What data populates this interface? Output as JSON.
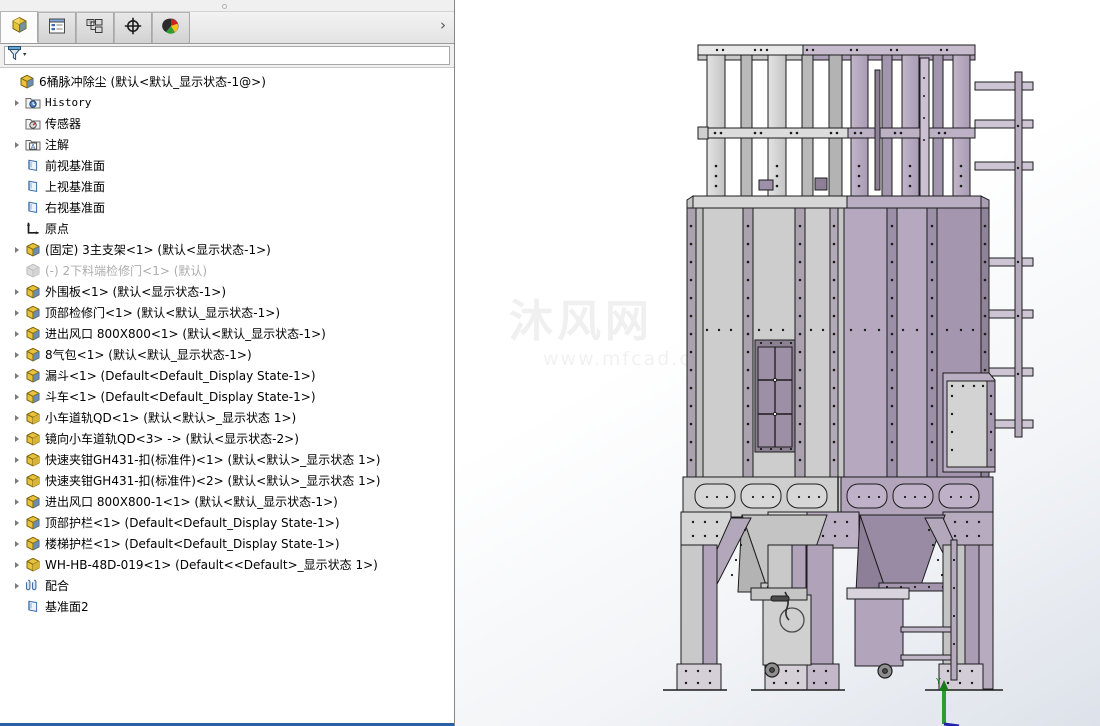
{
  "window": {
    "app": "SolidWorks",
    "watermark_text": "沐风网",
    "watermark_url": "www.mfcad.com"
  },
  "tabs": [
    {
      "name": "feature-manager-tab",
      "icon": "yellow-cube-icon",
      "label": "FeatureManager",
      "active": true
    },
    {
      "name": "property-manager-tab",
      "icon": "property-list-icon",
      "label": "PropertyManager",
      "active": false
    },
    {
      "name": "configuration-manager-tab",
      "icon": "configuration-icon",
      "label": "ConfigurationManager",
      "active": false
    },
    {
      "name": "dimxpert-manager-tab",
      "icon": "crosshair-icon",
      "label": "DimXpertManager",
      "active": false
    },
    {
      "name": "display-manager-tab",
      "icon": "color-wheel-icon",
      "label": "DisplayManager",
      "active": false
    }
  ],
  "tab_expand_glyph": "›",
  "filter": {
    "icon": "filter-funnel-icon",
    "value": "",
    "placeholder": ""
  },
  "tree": {
    "root": {
      "label": "6桶脉冲除尘    (默认<默认_显示状态-1@>)",
      "icon": "assembly-icon",
      "indent": 0,
      "arrow": false,
      "dim": false
    },
    "items": [
      {
        "label": "History",
        "icon": "history-folder-icon",
        "indent": 1,
        "arrow": true,
        "dim": false,
        "mono": true
      },
      {
        "label": "传感器",
        "icon": "sensor-folder-icon",
        "indent": 1,
        "arrow": false,
        "dim": false,
        "mono": false
      },
      {
        "label": "注解",
        "icon": "annotation-folder-icon",
        "indent": 1,
        "arrow": true,
        "dim": false,
        "mono": false
      },
      {
        "label": "前视基准面",
        "icon": "plane-icon",
        "indent": 1,
        "arrow": false,
        "dim": false,
        "mono": false
      },
      {
        "label": "上视基准面",
        "icon": "plane-icon",
        "indent": 1,
        "arrow": false,
        "dim": false,
        "mono": false
      },
      {
        "label": "右视基准面",
        "icon": "plane-icon",
        "indent": 1,
        "arrow": false,
        "dim": false,
        "mono": false
      },
      {
        "label": "原点",
        "icon": "origin-icon",
        "indent": 1,
        "arrow": false,
        "dim": false,
        "mono": false
      },
      {
        "label": "(固定) 3主支架<1>  (默认<显示状态-1>)",
        "icon": "assembly-icon",
        "indent": 1,
        "arrow": true,
        "dim": false,
        "mono": false
      },
      {
        "label": "(-) 2下料端检修门<1>  (默认)",
        "icon": "part-dim-icon",
        "indent": 1,
        "arrow": false,
        "dim": true,
        "mono": false
      },
      {
        "label": "外围板<1>  (默认<显示状态-1>)",
        "icon": "assembly-icon",
        "indent": 1,
        "arrow": true,
        "dim": false,
        "mono": false
      },
      {
        "label": "顶部检修门<1>  (默认<默认_显示状态-1>)",
        "icon": "assembly-icon",
        "indent": 1,
        "arrow": true,
        "dim": false,
        "mono": false
      },
      {
        "label": "进出风口 800X800<1>  (默认<默认_显示状态-1>)",
        "icon": "assembly-icon",
        "indent": 1,
        "arrow": true,
        "dim": false,
        "mono": false
      },
      {
        "label": "8气包<1>  (默认<默认_显示状态-1>)",
        "icon": "assembly-icon",
        "indent": 1,
        "arrow": true,
        "dim": false,
        "mono": false
      },
      {
        "label": "漏斗<1>  (Default<Default_Display State-1>)",
        "icon": "assembly-icon",
        "indent": 1,
        "arrow": true,
        "dim": false,
        "mono": false
      },
      {
        "label": "斗车<1>  (Default<Default_Display State-1>)",
        "icon": "assembly-icon",
        "indent": 1,
        "arrow": true,
        "dim": false,
        "mono": false
      },
      {
        "label": "小车道轨QD<1>  (默认<默认>_显示状态 1>)",
        "icon": "part-icon",
        "indent": 1,
        "arrow": true,
        "dim": false,
        "mono": false
      },
      {
        "label": "镜向小车道轨QD<3> ->  (默认<显示状态-2>)",
        "icon": "part-icon",
        "indent": 1,
        "arrow": true,
        "dim": false,
        "mono": false
      },
      {
        "label": "快速夹钳GH431-扣(标准件)<1>  (默认<默认>_显示状态 1>)",
        "icon": "part-icon",
        "indent": 1,
        "arrow": true,
        "dim": false,
        "mono": false
      },
      {
        "label": "快速夹钳GH431-扣(标准件)<2>  (默认<默认>_显示状态 1>)",
        "icon": "part-icon",
        "indent": 1,
        "arrow": true,
        "dim": false,
        "mono": false
      },
      {
        "label": "进出风口 800X800-1<1>  (默认<默认_显示状态-1>)",
        "icon": "assembly-icon",
        "indent": 1,
        "arrow": true,
        "dim": false,
        "mono": false
      },
      {
        "label": "顶部护栏<1>  (Default<Default_Display State-1>)",
        "icon": "assembly-icon",
        "indent": 1,
        "arrow": true,
        "dim": false,
        "mono": false
      },
      {
        "label": "楼梯护栏<1>  (Default<Default_Display State-1>)",
        "icon": "assembly-icon",
        "indent": 1,
        "arrow": true,
        "dim": false,
        "mono": false
      },
      {
        "label": "WH-HB-48D-019<1>  (Default<<Default>_显示状态 1>)",
        "icon": "part-icon",
        "indent": 1,
        "arrow": true,
        "dim": false,
        "mono": false
      },
      {
        "label": "配合",
        "icon": "mates-paperclip-icon",
        "indent": 1,
        "arrow": true,
        "dim": false,
        "mono": false
      },
      {
        "label": "基准面2",
        "icon": "plane-icon",
        "indent": 1,
        "arrow": false,
        "dim": false,
        "mono": false
      }
    ]
  },
  "viewport": {
    "model_name": "6桶脉冲除尘",
    "axis": {
      "y_label": "Y",
      "y_color": "#1a7a1a",
      "z_color": "#1a1a8c"
    },
    "colors": {
      "steel_light": "#cdcdcd",
      "steel_purple": "#b5a8bf",
      "steel_purple_dark": "#9d90aa",
      "outline": "#1a1a1a",
      "background_top": "#ffffff",
      "background_bottom": "#dde2ea"
    }
  }
}
